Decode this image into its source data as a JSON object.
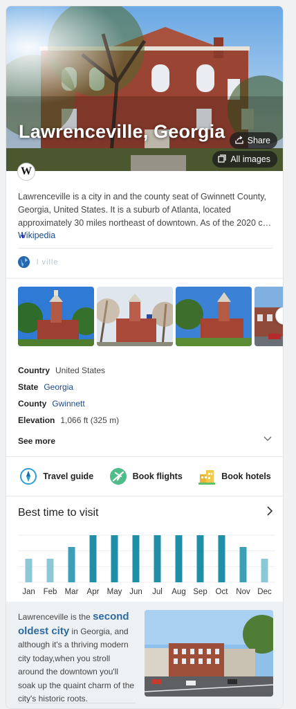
{
  "hero": {
    "title": "Lawrenceville, Georgia",
    "share_label": "Share",
    "images_label": "All images",
    "wiki_badge": "W"
  },
  "description": {
    "text": "Lawrenceville is a city in and the county seat of Gwinnett County, Georgia, United States. It is a suburb of Atlanta, located approximately 30 miles northeast of downtown. As of the 2020 c…",
    "more_label": "+",
    "source_label": "Wikipedia"
  },
  "website": {
    "url": "l       ville  ",
    "icon": "globe-icon"
  },
  "facts": [
    {
      "key": "Country",
      "value": "United States"
    },
    {
      "key": "State",
      "value": "Georgia"
    },
    {
      "key": "County",
      "value": "Gwinnett"
    },
    {
      "key": "Elevation",
      "value": "1,066 ft (325 m)"
    }
  ],
  "see_more_label": "See more",
  "actions": [
    {
      "label": "Travel guide",
      "icon": "compass-icon"
    },
    {
      "label": "Book flights",
      "icon": "plane-icon"
    },
    {
      "label": "Book hotels",
      "icon": "hotel-icon"
    }
  ],
  "best_time": {
    "title": "Best time to visit"
  },
  "chart_data": {
    "type": "bar",
    "categories": [
      "Jan",
      "Feb",
      "Mar",
      "Apr",
      "May",
      "Jun",
      "Jul",
      "Aug",
      "Sep",
      "Oct",
      "Nov",
      "Dec"
    ],
    "values": [
      2,
      2,
      3,
      4,
      4,
      4,
      4,
      4,
      4,
      4,
      3,
      2
    ],
    "ylim": [
      0,
      4
    ],
    "grid": true,
    "colors": {
      "high": "#1f8fa8",
      "mid": "#3aa0b8",
      "low": "#8cc7d6"
    }
  },
  "promo": {
    "pre": "Lawrenceville is the ",
    "highlight": "second oldest city",
    "post": " in Georgia, and although it's a thriving modern city today,when you stroll around the downtown you'll soak up the quaint charm of the city's historic roots."
  },
  "colors": {
    "link": "#1a4a8a",
    "accent": "#1f8fa8"
  }
}
